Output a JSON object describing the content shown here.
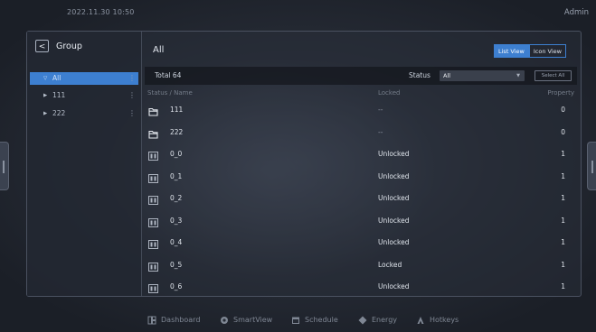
{
  "topbar": {
    "datetime": "2022.11.30  10:50",
    "user": "Admin"
  },
  "sidebar": {
    "back_label": "<",
    "title": "Group",
    "items": [
      {
        "arrow": "▽",
        "label": "All",
        "dots": "⋮",
        "selected": true
      },
      {
        "arrow": "▶",
        "label": "111",
        "dots": "⋮"
      },
      {
        "arrow": "▶",
        "label": "222",
        "dots": "⋮"
      }
    ]
  },
  "main": {
    "title": "All",
    "view_toggle": {
      "list": "List View",
      "icon": "Icon View",
      "active": "List View"
    },
    "toolbar": {
      "total": "Total  64",
      "status_label": "Status",
      "status_value": "All",
      "select_all": "Select All"
    },
    "columns": {
      "name": "Status / Name",
      "locked": "Locked",
      "property": "Property"
    },
    "rows": [
      {
        "icon": "folder-icon",
        "name": "111",
        "locked": "--",
        "property": "0"
      },
      {
        "icon": "folder-icon",
        "name": "222",
        "locked": "--",
        "property": "0"
      },
      {
        "icon": "device-icon",
        "name": "0_0",
        "locked": "Unlocked",
        "property": "1"
      },
      {
        "icon": "device-icon",
        "name": "0_1",
        "locked": "Unlocked",
        "property": "1"
      },
      {
        "icon": "device-icon",
        "name": "0_2",
        "locked": "Unlocked",
        "property": "1"
      },
      {
        "icon": "device-icon",
        "name": "0_3",
        "locked": "Unlocked",
        "property": "1"
      },
      {
        "icon": "device-icon",
        "name": "0_4",
        "locked": "Unlocked",
        "property": "1"
      },
      {
        "icon": "device-icon",
        "name": "0_5",
        "locked": "Locked",
        "property": "1"
      },
      {
        "icon": "device-icon",
        "name": "0_6",
        "locked": "Unlocked",
        "property": "1"
      }
    ]
  },
  "bottom_nav": [
    {
      "icon": "dashboard-icon",
      "label": "Dashboard"
    },
    {
      "icon": "smartview-icon",
      "label": "SmartView"
    },
    {
      "icon": "schedule-icon",
      "label": "Schedule"
    },
    {
      "icon": "energy-icon",
      "label": "Energy"
    },
    {
      "icon": "hotkeys-icon",
      "label": "Hotkeys"
    }
  ],
  "colors": {
    "accent": "#3d7fd0",
    "panel_border": "#4a5160",
    "background": "#262b35"
  }
}
